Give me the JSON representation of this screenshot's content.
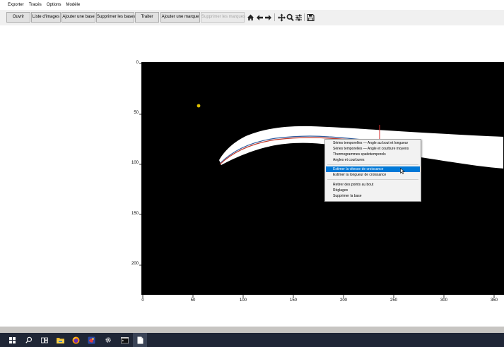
{
  "menubar": {
    "items": [
      "Exporter",
      "Tracés",
      "Options",
      "Modèle"
    ]
  },
  "toolbar": {
    "buttons": [
      "Ouvrir",
      "Liste d'images",
      "Ajouter une base",
      "Supprimer les bases",
      "Traiter",
      "Ajouter une marque",
      "Supprimer les marques"
    ],
    "icons": [
      "home-icon",
      "back-arrow-icon",
      "forward-arrow-icon",
      "pan-icon",
      "zoom-icon",
      "configure-subplots-icon",
      "save-icon"
    ]
  },
  "plot": {
    "x_ticks": [
      "0",
      "50",
      "100",
      "150",
      "200",
      "250",
      "300",
      "350"
    ],
    "y_ticks": [
      "0",
      "50",
      "100",
      "150",
      "200"
    ],
    "marker_color": "#e0c000",
    "curve_color_red": "#c0392b",
    "curve_color_blue": "#2d5a9c",
    "base_marker_color": "#d62728"
  },
  "context_menu": {
    "group1": [
      "Séries temporelles — Angle au bout et longueur",
      "Séries temporelles — Angle et courbure moyens",
      "Thermogrammes spatiotemporels",
      "Angles et courbures"
    ],
    "group2": [
      "Estimer la vitesse de croissance",
      "Estimer la longueur de croissance"
    ],
    "group3": [
      "Retirer des points au bout",
      "Réglages",
      "Supprimer la base"
    ],
    "highlight_color": "#0078d7"
  },
  "taskbar": {
    "icons": [
      "windows-start-icon",
      "search-icon",
      "task-view-icon",
      "file-explorer-icon",
      "firefox-icon",
      "python-app-icon",
      "settings-icon",
      "terminal-icon",
      "document-icon"
    ]
  }
}
